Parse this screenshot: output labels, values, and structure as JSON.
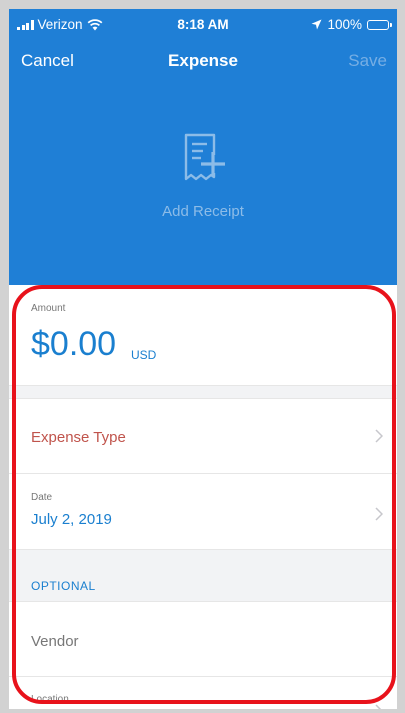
{
  "status_bar": {
    "carrier": "Verizon",
    "time": "8:18 AM",
    "battery": "100%",
    "icons": [
      "signal-icon",
      "wifi-icon",
      "location-arrow-icon",
      "battery-icon"
    ]
  },
  "nav": {
    "cancel_label": "Cancel",
    "title": "Expense",
    "save_label": "Save"
  },
  "receipt": {
    "icon": "receipt-add-icon",
    "label": "Add Receipt"
  },
  "form": {
    "amount": {
      "label": "Amount",
      "value": "$0.00",
      "currency": "USD"
    },
    "expense_type": {
      "label": "Expense Type"
    },
    "date": {
      "label": "Date",
      "value": "July 2, 2019"
    },
    "optional_section": {
      "label": "OPTIONAL"
    },
    "vendor": {
      "label": "Vendor"
    },
    "location": {
      "label": "Location"
    }
  },
  "colors": {
    "header_background": "#1f7fd6",
    "accent": "#1a7fcf",
    "required_field": "#c0544c",
    "annotation": "#e8121b"
  }
}
